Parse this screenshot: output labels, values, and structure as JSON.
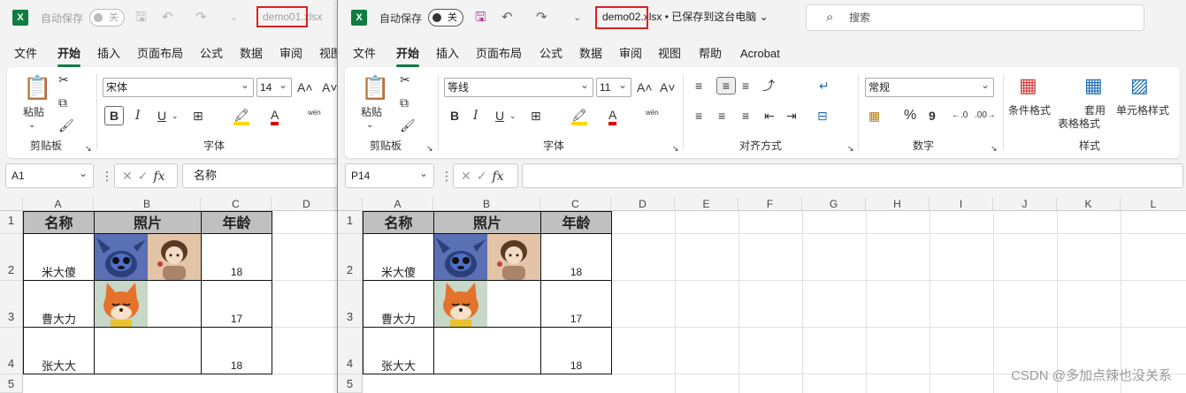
{
  "watermark": "CSDN @多加点辣也没关系",
  "window1": {
    "app_icon": "X",
    "autosave_label": "自动保存",
    "autosave_state": "关",
    "filename_highlight": "demo01",
    "filename_rest": ".xlsx",
    "menu": [
      "文件",
      "开始",
      "插入",
      "页面布局",
      "公式",
      "数据",
      "审阅",
      "视图"
    ],
    "font_name": "宋体",
    "font_size": "14",
    "groups": {
      "clipboard": "剪贴板",
      "font": "字体"
    },
    "paste_label": "粘贴",
    "bold": "B",
    "italic": "I",
    "underline": "U",
    "wen": "wén",
    "name_box": "A1",
    "formula": "名称",
    "columns": [
      "A",
      "B",
      "C",
      "D"
    ],
    "rows": [
      "1",
      "2",
      "3",
      "4",
      "5"
    ],
    "headers": [
      "名称",
      "照片",
      "年龄"
    ],
    "data": [
      {
        "name": "米大傻",
        "age": "18"
      },
      {
        "name": "曹大力",
        "age": "17"
      },
      {
        "name": "张大大",
        "age": "18"
      }
    ]
  },
  "window2": {
    "app_icon": "X",
    "autosave_label": "自动保存",
    "autosave_state": "关",
    "filename_highlight": "demo02",
    "filename_rest": ".xlsx • 已保存到这台电脑",
    "search_placeholder": "搜索",
    "menu": [
      "文件",
      "开始",
      "插入",
      "页面布局",
      "公式",
      "数据",
      "审阅",
      "视图",
      "帮助",
      "Acrobat"
    ],
    "font_name": "等线",
    "font_size": "11",
    "number_format": "常规",
    "groups": {
      "clipboard": "剪贴板",
      "font": "字体",
      "alignment": "对齐方式",
      "number": "数字",
      "styles": "样式"
    },
    "paste_label": "粘贴",
    "bold": "B",
    "italic": "I",
    "underline": "U",
    "wen": "wén",
    "percent": "%",
    "comma": "9",
    "style_buttons": {
      "conditional": "条件格式",
      "table_a": "套用",
      "table_b": "表格格式",
      "cell_styles": "单元格样式"
    },
    "name_box": "P14",
    "formula": "",
    "columns": [
      "A",
      "B",
      "C",
      "D",
      "E",
      "F",
      "G",
      "H",
      "I",
      "J",
      "K",
      "L"
    ],
    "rows": [
      "1",
      "2",
      "3",
      "4",
      "5"
    ],
    "headers": [
      "名称",
      "照片",
      "年龄"
    ],
    "data": [
      {
        "name": "米大傻",
        "age": "18"
      },
      {
        "name": "曹大力",
        "age": "17"
      },
      {
        "name": "张大大",
        "age": "18"
      }
    ]
  }
}
